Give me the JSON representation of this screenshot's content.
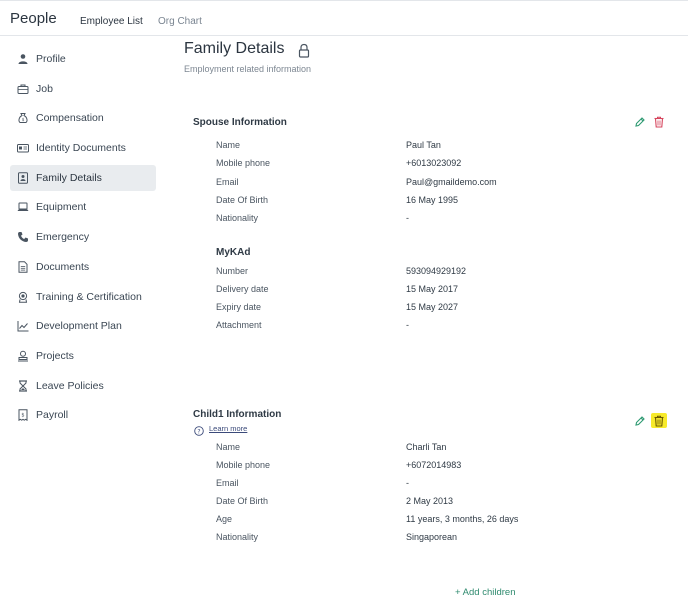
{
  "app": {
    "title": "People",
    "tabs": [
      {
        "label": "Employee List",
        "active": true
      },
      {
        "label": "Org Chart",
        "active": false
      }
    ]
  },
  "sidebar": {
    "items": [
      {
        "label": "Profile",
        "icon": "user-icon"
      },
      {
        "label": "Job",
        "icon": "briefcase-icon"
      },
      {
        "label": "Compensation",
        "icon": "money-bag-icon"
      },
      {
        "label": "Identity Documents",
        "icon": "id-card-icon"
      },
      {
        "label": "Family Details",
        "icon": "family-card-icon",
        "active": true
      },
      {
        "label": "Equipment",
        "icon": "laptop-icon"
      },
      {
        "label": "Emergency",
        "icon": "phone-icon"
      },
      {
        "label": "Documents",
        "icon": "document-icon"
      },
      {
        "label": "Training & Certification",
        "icon": "award-icon"
      },
      {
        "label": "Development Plan",
        "icon": "chart-line-icon"
      },
      {
        "label": "Projects",
        "icon": "project-icon"
      },
      {
        "label": "Leave Policies",
        "icon": "hourglass-icon"
      },
      {
        "label": "Payroll",
        "icon": "receipt-icon"
      }
    ]
  },
  "main": {
    "title": "Family Details",
    "subtitle": "Employment related information",
    "spouse": {
      "title": "Spouse Information",
      "rows": [
        {
          "label": "Name",
          "value": "Paul Tan"
        },
        {
          "label": "Mobile phone",
          "value": "+6013023092"
        },
        {
          "label": "Email",
          "value": "Paul@gmaildemo.com"
        },
        {
          "label": "Date Of Birth",
          "value": "16 May 1995"
        },
        {
          "label": "Nationality",
          "value": "-"
        }
      ],
      "mykad": {
        "title": "MyKAd",
        "rows": [
          {
            "label": "Number",
            "value": "593094929192"
          },
          {
            "label": "Delivery date",
            "value": "15 May 2017"
          },
          {
            "label": "Expiry date",
            "value": "15 May 2027"
          },
          {
            "label": "Attachment",
            "value": "-"
          }
        ]
      }
    },
    "child1": {
      "title": "Child1 Information",
      "learn_more": "Learn more",
      "rows": [
        {
          "label": "Name",
          "value": "Charli Tan"
        },
        {
          "label": "Mobile phone",
          "value": "+6072014983"
        },
        {
          "label": "Email",
          "value": "-"
        },
        {
          "label": "Date Of Birth",
          "value": "2 May 2013"
        },
        {
          "label": "Age",
          "value": "11 years, 3 months, 26 days"
        },
        {
          "label": "Nationality",
          "value": "Singaporean"
        }
      ]
    },
    "add_children": "+ Add children"
  },
  "colors": {
    "edit": "#2e9a72",
    "delete": "#d6455d",
    "highlight": "#f7ea2b",
    "active_bg": "#e9ecef"
  }
}
